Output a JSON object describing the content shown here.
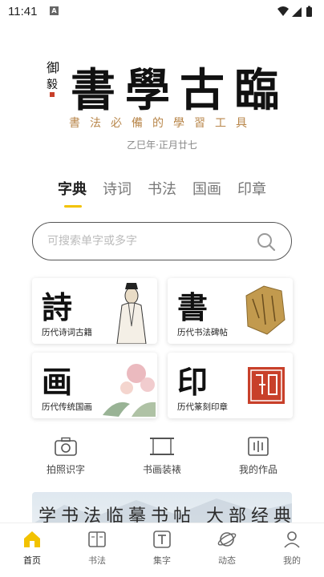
{
  "status_bar": {
    "time": "11:41",
    "notif_icon": "a-notification-icon"
  },
  "header": {
    "title_chars": [
      "書",
      "學",
      "古",
      "臨"
    ],
    "seal_text": "御",
    "slogan": "書法必備的學習工具",
    "date": "乙巳年·正月廿七"
  },
  "tabs": [
    {
      "label": "字典",
      "active": true
    },
    {
      "label": "诗词",
      "active": false
    },
    {
      "label": "书法",
      "active": false
    },
    {
      "label": "国画",
      "active": false
    },
    {
      "label": "印章",
      "active": false
    }
  ],
  "search": {
    "placeholder": "可搜索单字或多字",
    "value": ""
  },
  "cards": [
    {
      "char": "詩",
      "label": "历代诗词古籍",
      "icon": "scholar-portrait"
    },
    {
      "char": "書",
      "label": "历代书法碑帖",
      "icon": "stele-rubbing"
    },
    {
      "char": "画",
      "label": "历代传统国画",
      "icon": "flower-painting"
    },
    {
      "char": "印",
      "label": "历代篆刻印章",
      "icon": "red-seal"
    }
  ],
  "quick_actions": [
    {
      "label": "拍照识字",
      "icon": "camera-icon"
    },
    {
      "label": "书画装裱",
      "icon": "frame-icon"
    },
    {
      "label": "我的作品",
      "icon": "works-icon"
    }
  ],
  "banner": {
    "text": "学书法临摹书帖 大部经典名片"
  },
  "bottom_nav": [
    {
      "label": "首页",
      "icon": "home-icon",
      "active": true
    },
    {
      "label": "书法",
      "icon": "book-icon",
      "active": false
    },
    {
      "label": "集字",
      "icon": "text-box-icon",
      "active": false
    },
    {
      "label": "动态",
      "icon": "planet-icon",
      "active": false
    },
    {
      "label": "我的",
      "icon": "user-icon",
      "active": false
    }
  ],
  "colors": {
    "accent": "#f2c200",
    "seal_red": "#c8402a",
    "slogan": "#b8864a"
  }
}
